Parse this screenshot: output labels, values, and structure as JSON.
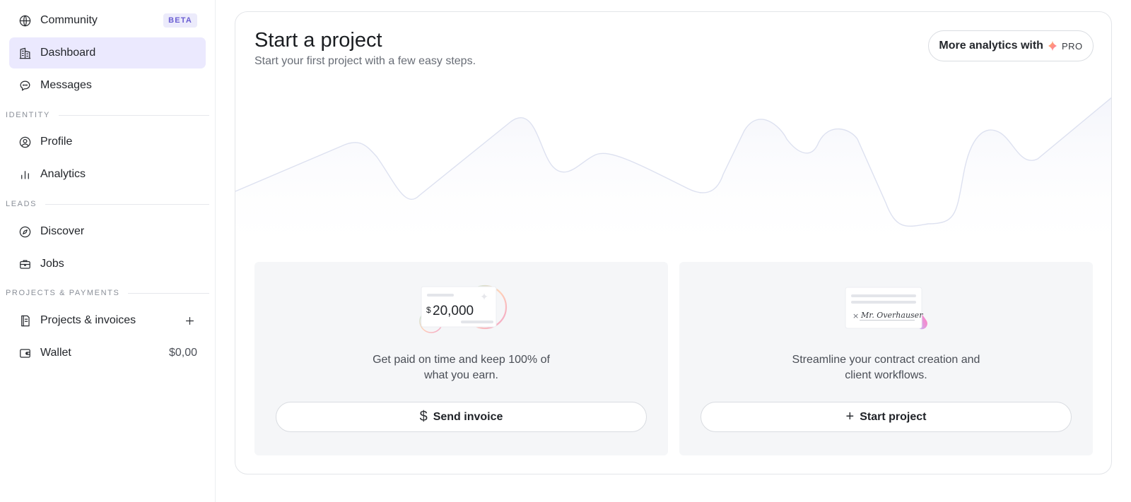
{
  "sidebar": {
    "community": {
      "label": "Community",
      "badge": "BETA"
    },
    "dashboard": {
      "label": "Dashboard"
    },
    "messages": {
      "label": "Messages"
    },
    "identity_section": "IDENTITY",
    "profile": {
      "label": "Profile"
    },
    "analytics": {
      "label": "Analytics"
    },
    "leads_section": "LEADS",
    "discover": {
      "label": "Discover"
    },
    "jobs": {
      "label": "Jobs"
    },
    "projects_section": "PROJECTS & PAYMENTS",
    "projects_invoices": {
      "label": "Projects & invoices"
    },
    "wallet": {
      "label": "Wallet",
      "value": "$0,00"
    }
  },
  "main": {
    "title": "Start a project",
    "subtitle": "Start your first project with a few easy steps.",
    "pro_button": {
      "label": "More analytics with",
      "tag": "PRO"
    },
    "invoice_card": {
      "amount_currency": "$",
      "amount": "20,000",
      "description": "Get paid on time and keep 100% of what you earn.",
      "button_label": "Send invoice"
    },
    "contract_card": {
      "signature": "Mr. Overhauser",
      "description": "Streamline your contract creation and client workflows.",
      "button_label": "Start project"
    }
  },
  "colors": {
    "accent_active": "#ebe9fe",
    "badge_text": "#6b5fd3",
    "wave_stroke": "#dde1f0"
  }
}
